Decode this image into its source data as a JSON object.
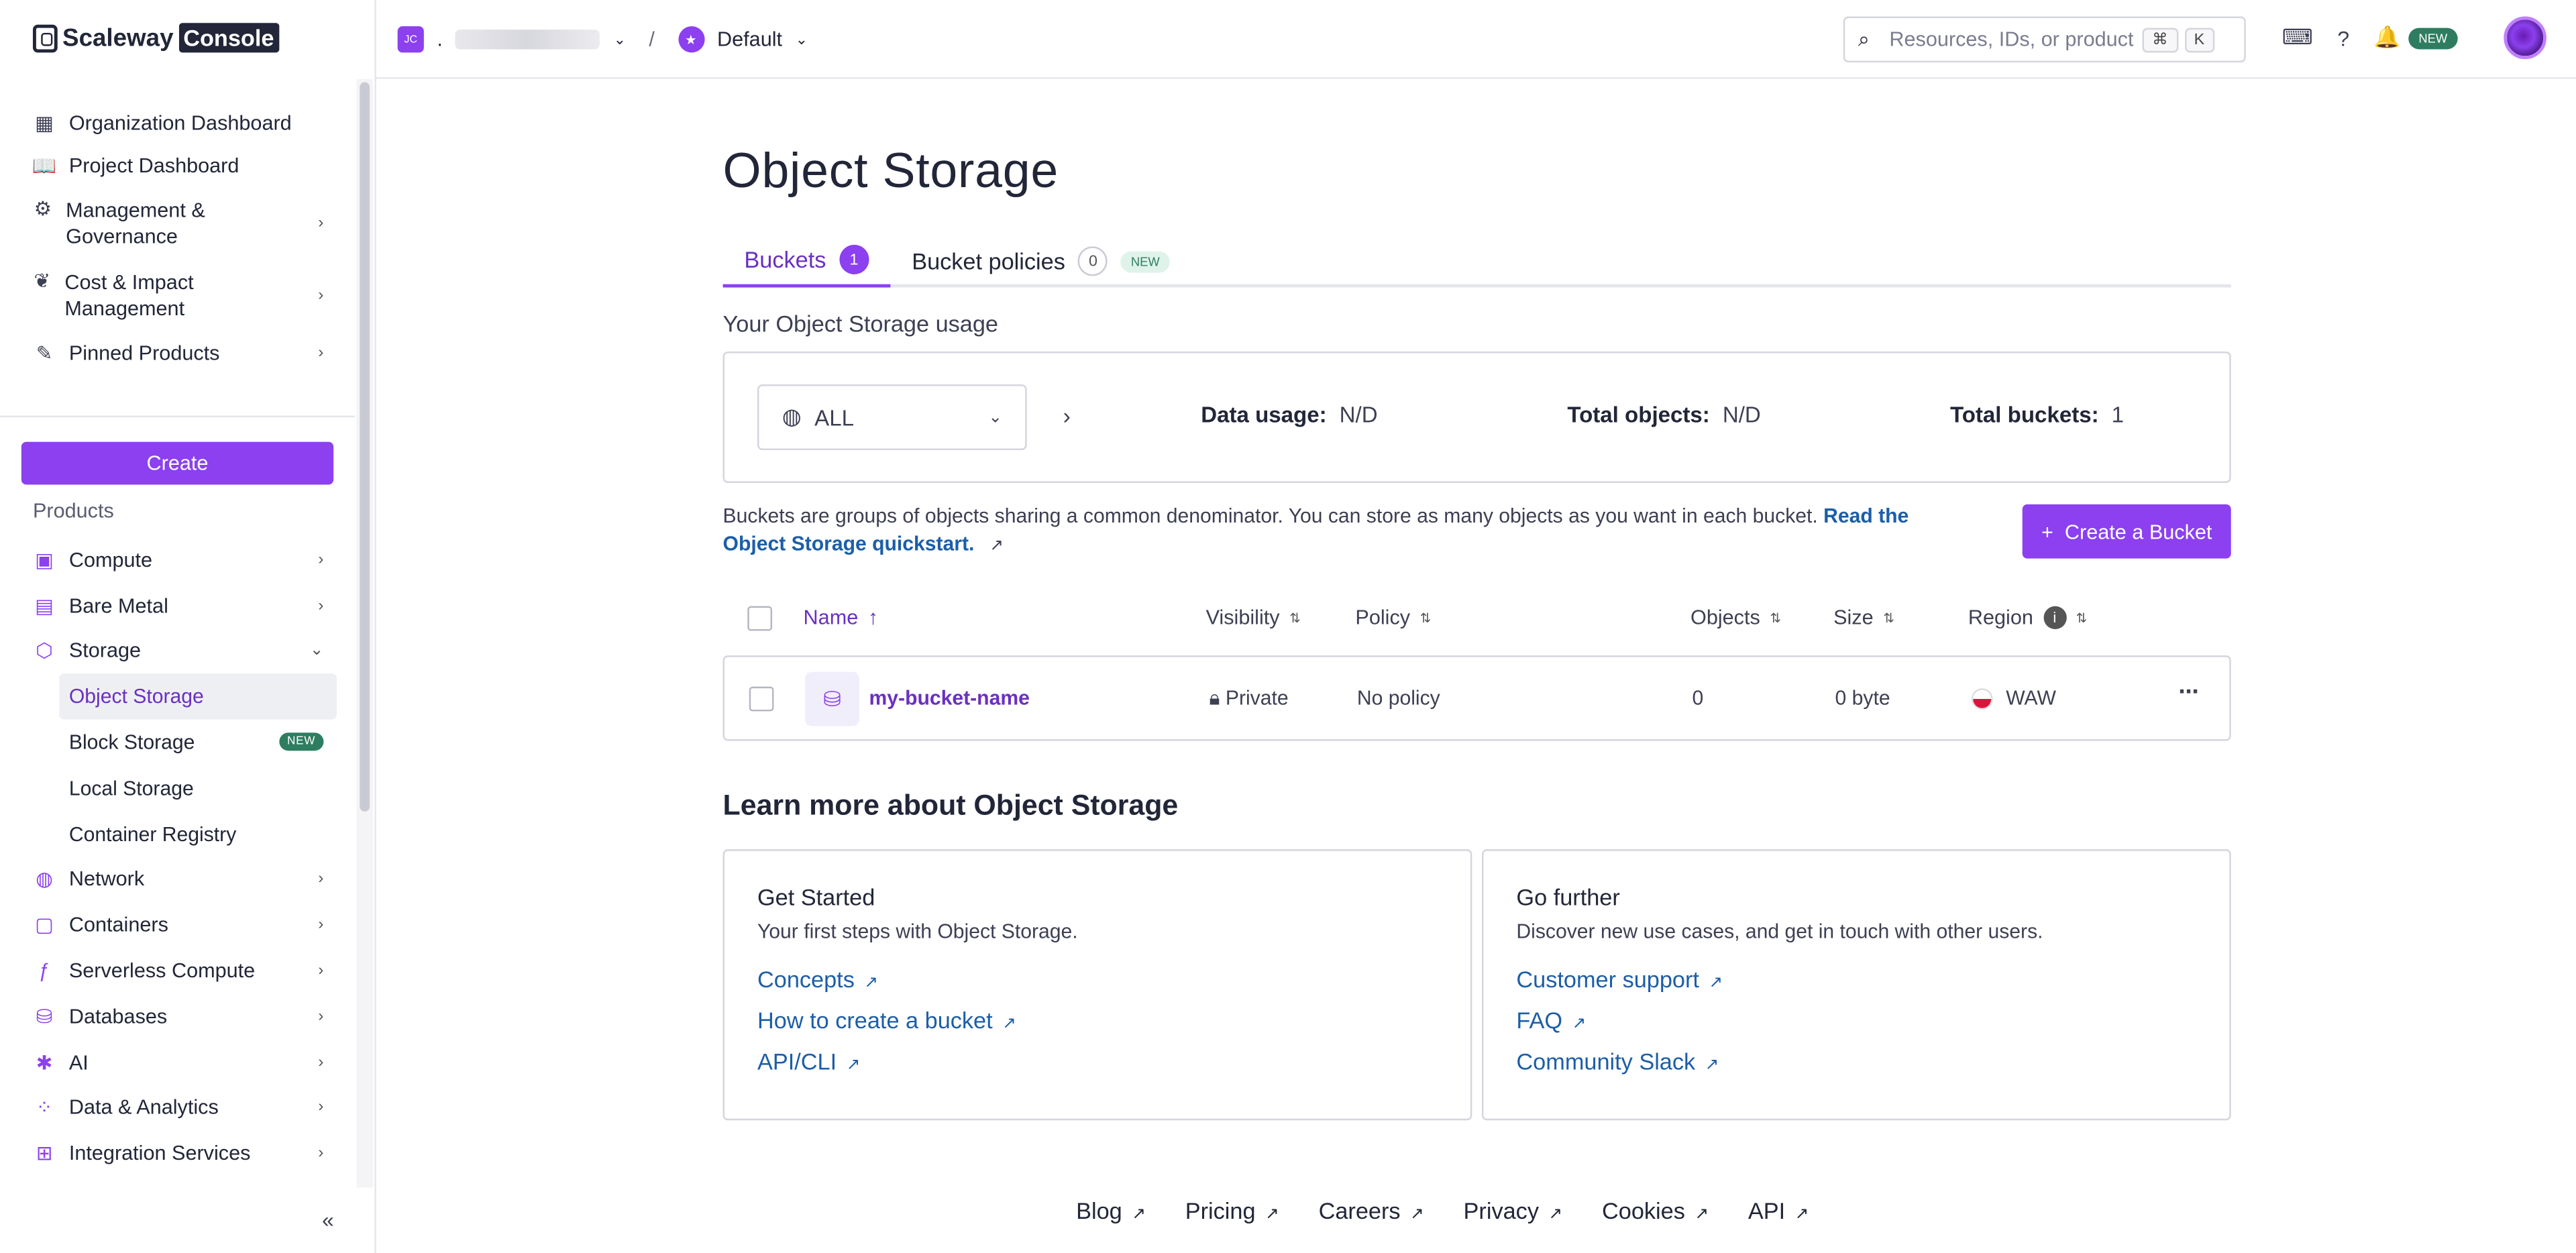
{
  "brand": {
    "name": "Scaleway",
    "console": "Console"
  },
  "topbar": {
    "org_initials": "JC",
    "org_name": ".",
    "separator": "/",
    "project": "Default",
    "search_placeholder": "Resources, IDs, or product",
    "kbd_cmd": "⌘",
    "kbd_k": "K",
    "new_badge": "NEW"
  },
  "sidebar": {
    "top_items": [
      {
        "label": "Organization Dashboard",
        "icon": "dashboard-icon"
      },
      {
        "label": "Project Dashboard",
        "icon": "book-icon"
      },
      {
        "label": "Management & Governance",
        "icon": "gear-icon"
      },
      {
        "label": "Cost & Impact Management",
        "icon": "leaf-icon"
      },
      {
        "label": "Pinned Products",
        "icon": "pin-icon"
      }
    ],
    "create_label": "Create",
    "products_label": "Products",
    "products": [
      {
        "label": "Compute"
      },
      {
        "label": "Bare Metal"
      },
      {
        "label": "Storage"
      },
      {
        "label": "Network"
      },
      {
        "label": "Containers"
      },
      {
        "label": "Serverless Compute"
      },
      {
        "label": "Databases"
      },
      {
        "label": "AI"
      },
      {
        "label": "Data & Analytics"
      },
      {
        "label": "Integration Services"
      }
    ],
    "storage_sub": [
      {
        "label": "Object Storage"
      },
      {
        "label": "Block Storage",
        "badge": "NEW"
      },
      {
        "label": "Local Storage"
      },
      {
        "label": "Container Registry"
      }
    ]
  },
  "main": {
    "title": "Object Storage",
    "tabs": [
      {
        "label": "Buckets",
        "count": "1"
      },
      {
        "label": "Bucket policies",
        "count": "0",
        "badge": "NEW"
      }
    ],
    "usage_title": "Your Object Storage usage",
    "region": "ALL",
    "data_usage_label": "Data usage:",
    "data_usage_value": "N/D",
    "total_objects_label": "Total objects:",
    "total_objects_value": "N/D",
    "total_buckets_label": "Total buckets:",
    "total_buckets_value": "1",
    "description": "Buckets are groups of objects sharing a common denominator. You can store as many objects as you want in each bucket.",
    "quickstart_link": "Read the Object Storage quickstart.",
    "create_bucket_label": "Create a Bucket",
    "columns": {
      "name": "Name",
      "visibility": "Visibility",
      "policy": "Policy",
      "objects": "Objects",
      "size": "Size",
      "region": "Region"
    },
    "rows": [
      {
        "name": "my-bucket-name",
        "visibility": "Private",
        "policy": "No policy",
        "objects": "0",
        "size": "0 byte",
        "region": "WAW"
      }
    ],
    "learn_title": "Learn more about Object Storage",
    "cards": [
      {
        "title": "Get Started",
        "subtitle": "Your first steps with Object Storage.",
        "links": [
          "Concepts",
          "How to create a bucket",
          "API/CLI"
        ]
      },
      {
        "title": "Go further",
        "subtitle": "Discover new use cases, and get in touch with other users.",
        "links": [
          "Customer support",
          "FAQ",
          "Community Slack"
        ]
      }
    ]
  },
  "footer": [
    "Blog",
    "Pricing",
    "Careers",
    "Privacy",
    "Cookies",
    "API"
  ],
  "colors": {
    "accent": "#8c40ef",
    "link": "#1c5ea8",
    "new_badge": "#2e7d61"
  }
}
